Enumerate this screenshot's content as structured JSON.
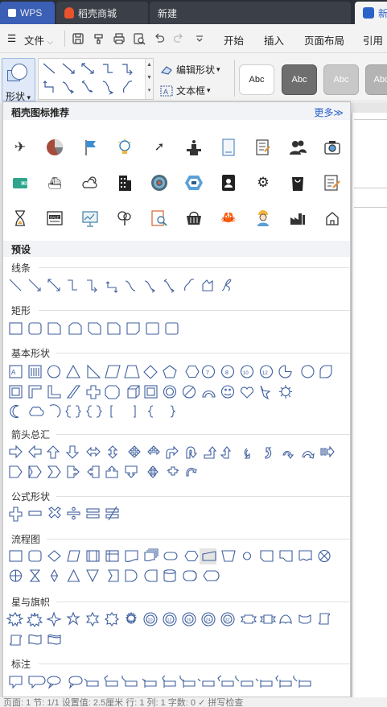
{
  "titlebar": {
    "tabs": [
      {
        "label": "WPS",
        "icon": "wps-logo-icon",
        "color": "#3a5fb5"
      },
      {
        "label": "稻壳商城",
        "icon": "docer-mall-icon",
        "color": "#e8532b"
      },
      {
        "label": "新建",
        "icon": "",
        "color": ""
      },
      {
        "label": "新",
        "icon": "writer-doc-icon",
        "color": "#2a62c9"
      }
    ]
  },
  "menubar": {
    "file_label": "文件",
    "items": [
      "开始",
      "插入",
      "页面布局",
      "引用"
    ],
    "quick_icons": [
      "save-icon",
      "format-painter-icon",
      "print-icon",
      "print-preview-icon",
      "undo-icon",
      "redo-icon",
      "more-dropdown-icon"
    ]
  },
  "ribbon": {
    "shape_button_label": "形状",
    "edit_shape_label": "编辑形状",
    "textbox_label": "文本框",
    "style_presets": [
      {
        "label": "Abc",
        "bg": "#ffffff",
        "fg": "#222222",
        "border": "#cfcfcf"
      },
      {
        "label": "Abc",
        "bg": "#6e6e6e",
        "fg": "#ffffff",
        "border": "#555555"
      },
      {
        "label": "Abc",
        "bg": "#c8c8c8",
        "fg": "#ffffff",
        "border": "#b0b0b0"
      },
      {
        "label": "Abc",
        "bg": "#b4b4b4",
        "fg": "#ffffff",
        "border": "#a0a0a0"
      }
    ]
  },
  "panel": {
    "recommend_title": "稻壳图标推荐",
    "more_label": "更多≫",
    "recommend_icons": [
      [
        "airplane-icon",
        "pie-chart-icon",
        "flag-icon",
        "lightbulb-icon",
        "rocket-icon",
        "podium-icon",
        "document-icon",
        "checklist-icon",
        "people-icon",
        "camera-icon"
      ],
      [
        "wallet-icon",
        "ship-icon",
        "cloud-sun-icon",
        "building-icon",
        "target-icon",
        "hexagon-badge-icon",
        "contacts-icon",
        "gear-icon",
        "shopping-bag-icon",
        "edit-note-icon"
      ],
      [
        "hourglass-icon",
        "sale-sign-icon",
        "presentation-icon",
        "tree-icon",
        "search-document-icon",
        "basket-icon",
        "crab-icon",
        "worker-icon",
        "factory-icon",
        "house-icon"
      ]
    ],
    "preset_label": "预设",
    "sections": [
      {
        "title": "线条"
      },
      {
        "title": "矩形"
      },
      {
        "title": "基本形状"
      },
      {
        "title": "箭头总汇"
      },
      {
        "title": "公式形状"
      },
      {
        "title": "流程图"
      },
      {
        "title": "星与旗帜"
      },
      {
        "title": "标注"
      }
    ]
  },
  "statusbar": {
    "text": "页面: 1   节: 1/1   设置值: 2.5厘米   行: 1   列: 1   字数: 0   ✓ 拼写检查"
  }
}
